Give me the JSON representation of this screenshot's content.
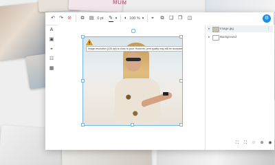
{
  "background": {
    "card_text": "MUM"
  },
  "toolbar": {
    "undo_icon": "undo-icon",
    "redo_icon": "redo-icon",
    "delete_icon": "delete-icon",
    "stroke_width": "0 pt",
    "zoom": "100 %"
  },
  "canvas": {
    "warning": {
      "icon": "warning-triangle-icon",
      "text": "Image resolution (105 dpi) is close to poor. However, print quality may still be acceptable but far from ideal."
    }
  },
  "layers_panel": {
    "items": [
      {
        "label": "Image.jpg",
        "selected": true
      },
      {
        "label": "Background",
        "selected": false
      }
    ]
  },
  "colors": {
    "accent": "#1a8fe3",
    "selection": "#6fb8ee",
    "warning": "#f0a400"
  }
}
